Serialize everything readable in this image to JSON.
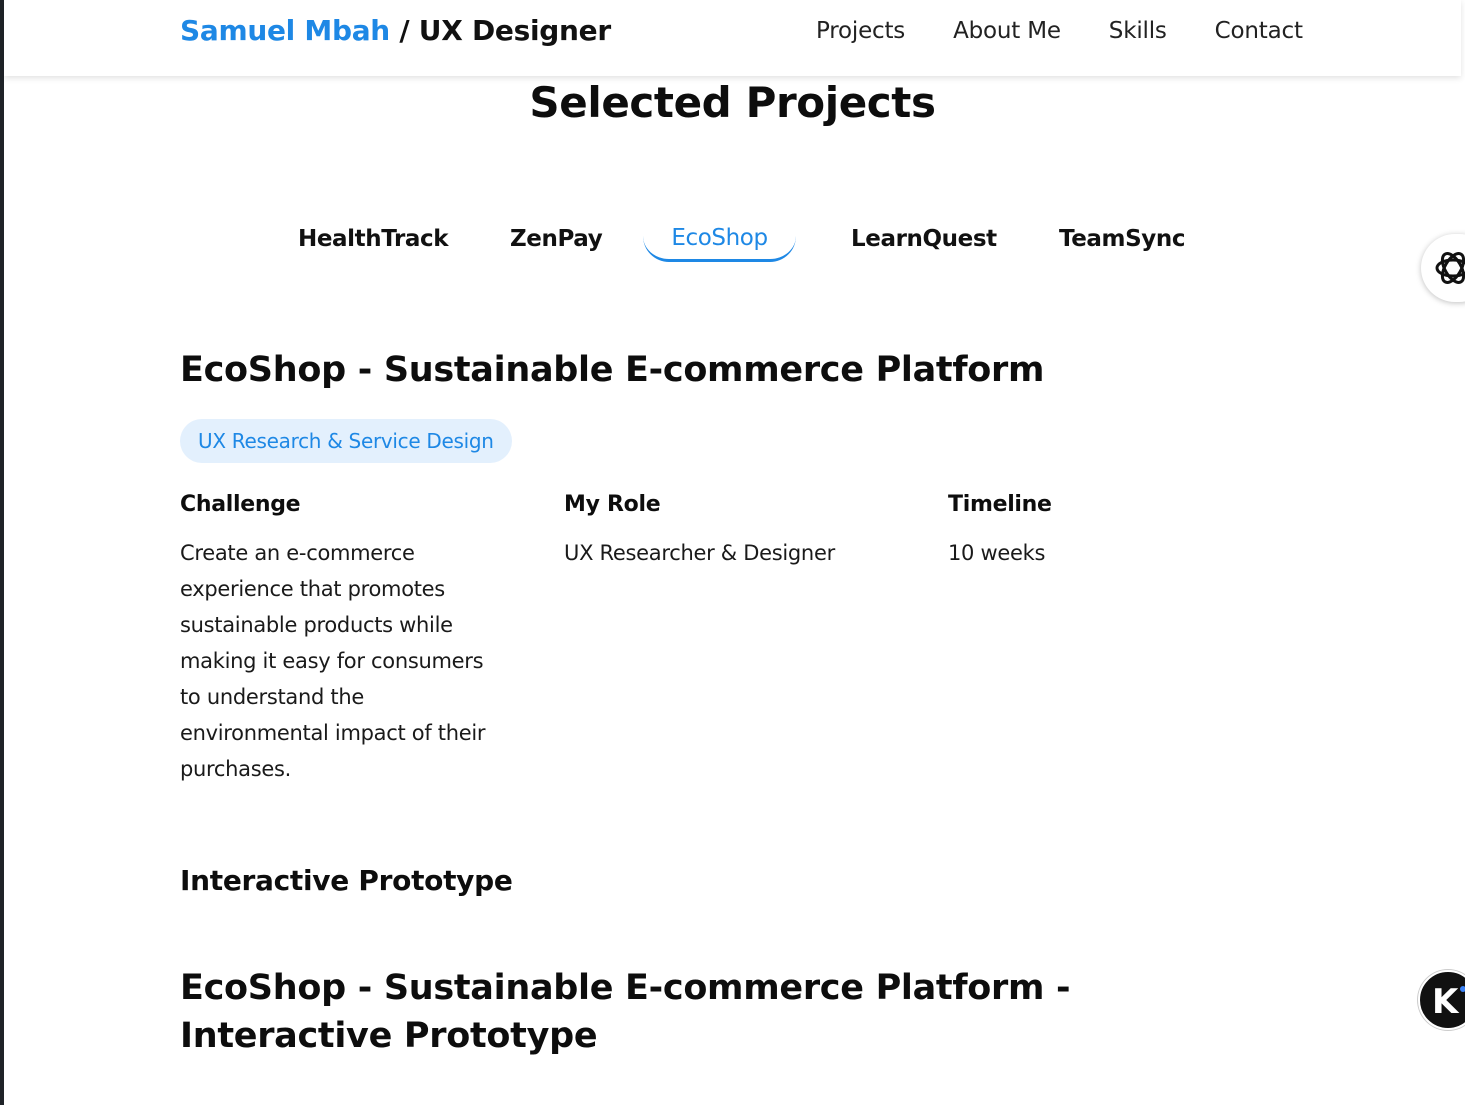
{
  "header": {
    "brand_name": "Samuel Mbah",
    "brand_sep": " / ",
    "brand_role": "UX Designer",
    "nav": [
      "Projects",
      "About Me",
      "Skills",
      "Contact"
    ]
  },
  "section": {
    "title": "Selected Projects"
  },
  "tabs": [
    {
      "label": "HealthTrack",
      "active": false
    },
    {
      "label": "ZenPay",
      "active": false
    },
    {
      "label": "EcoShop",
      "active": true
    },
    {
      "label": "LearnQuest",
      "active": false
    },
    {
      "label": "TeamSync",
      "active": false
    }
  ],
  "project": {
    "title": "EcoShop - Sustainable E-commerce Platform",
    "tag": "UX Research & Service Design",
    "challenge_label": "Challenge",
    "challenge_text": "Create an e-commerce experience that promotes sustainable products while making it easy for consumers to understand the environmental impact of their purchases.",
    "role_label": "My Role",
    "role_text": "UX Researcher & Designer",
    "timeline_label": "Timeline",
    "timeline_text": "10 weeks"
  },
  "prototype": {
    "subtitle": "Interactive Prototype",
    "title": "EcoShop - Sustainable E-commerce Platform - Interactive Prototype"
  },
  "colors": {
    "accent": "#1e88e5",
    "tag_bg": "#e3f0fd"
  },
  "icons": {
    "top_floating": "openai-logo-icon",
    "bottom_floating": "k-logo-icon"
  }
}
